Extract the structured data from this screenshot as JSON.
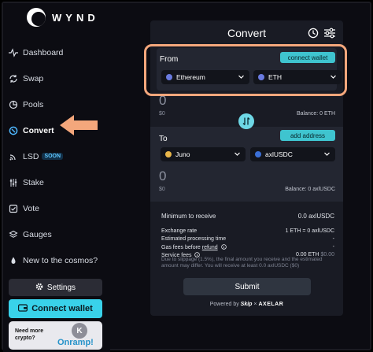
{
  "brand": {
    "name": "WYND"
  },
  "sidebar": {
    "items": [
      {
        "label": "Dashboard",
        "icon": "activity-icon"
      },
      {
        "label": "Swap",
        "icon": "refresh-icon"
      },
      {
        "label": "Pools",
        "icon": "pie-icon"
      },
      {
        "label": "Convert",
        "icon": "convert-icon",
        "active": true
      },
      {
        "label": "LSD",
        "icon": "wifi-icon",
        "badge": "SOON"
      },
      {
        "label": "Stake",
        "icon": "sliders-icon"
      },
      {
        "label": "Vote",
        "icon": "ballot-icon"
      },
      {
        "label": "Gauges",
        "icon": "layers-icon"
      },
      {
        "label": "New to the cosmos?",
        "icon": "drop-icon"
      }
    ],
    "settings_label": "Settings",
    "connect_label": "Connect wallet",
    "onramp_question": "Need more crypto?",
    "onramp_label": "Onramp!",
    "onramp_letter": "K"
  },
  "panel": {
    "title": "Convert",
    "from": {
      "label": "From",
      "action": "connect wallet",
      "chain": "Ethereum",
      "token": "ETH",
      "amount": "0",
      "usd": "$0",
      "balance": "Balance: 0 ETH"
    },
    "to": {
      "label": "To",
      "action": "add address",
      "chain": "Juno",
      "token": "axlUSDC",
      "amount": "0",
      "usd": "$0",
      "balance": "Balance: 0 axlUSDC"
    },
    "details": {
      "min_label": "Minimum to receive",
      "min_value": "0.0 axlUSDC",
      "exchange_label": "Exchange rate",
      "exchange_value": "1 ETH = 0 axlUSDC",
      "time_label": "Estimated processing time",
      "time_value": "-",
      "gas_label_prefix": "Gas fees before ",
      "gas_label_link": "refund",
      "gas_value": "-",
      "service_label": "Service fees",
      "service_value": "0.00 ETH",
      "service_usd": "$0.00"
    },
    "note": "Due to slippage (1.5%), the final amount you receive and the estimated amount may differ. You will receive at least 0.0 axlUSDC ($0)",
    "submit_label": "Submit",
    "powered_prefix": "Powered by",
    "powered_partner_a": "Skip",
    "powered_x": "×",
    "powered_partner_b": "AXELAR"
  },
  "colors": {
    "accent": "#39d2ea",
    "highlight": "#f4a77c",
    "panel": "#191b24",
    "active_icon": "#4fb8ff"
  }
}
